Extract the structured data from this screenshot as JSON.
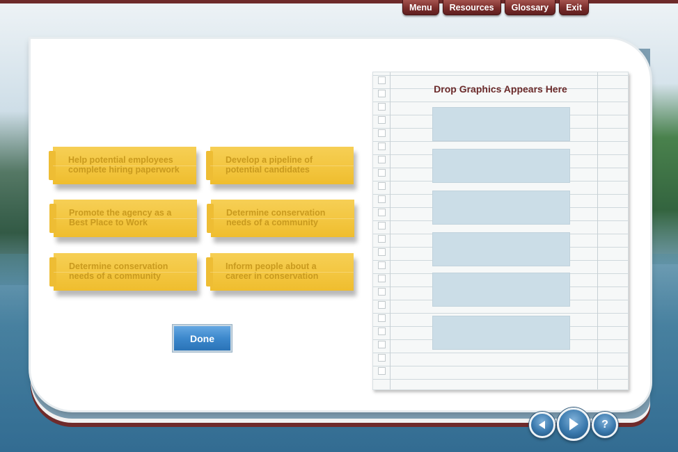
{
  "nav": {
    "menu": "Menu",
    "resources": "Resources",
    "glossary": "Glossary",
    "exit": "Exit"
  },
  "notes": [
    {
      "text": "Help potential employees complete hiring paperwork"
    },
    {
      "text": "Develop a pipeline of potential candidates"
    },
    {
      "text": "Promote the agency as a Best Place to Work"
    },
    {
      "text": "Determine conservation needs of a community"
    },
    {
      "text": "Determine conservation needs of a community"
    },
    {
      "text": "Inform people about a career in conservation"
    }
  ],
  "done_label": "Done",
  "notebook": {
    "title": "Drop Graphics Appears Here",
    "drop_zone_count": 6
  },
  "controls": {
    "back_icon": "back-arrow-icon",
    "next_icon": "next-arrow-icon",
    "help_icon": "help-icon",
    "help_glyph": "?"
  },
  "colors": {
    "nav": "#7b2d2b",
    "note": "#f3c640",
    "done": "#3c88cc",
    "drop_zone": "#cbdde7",
    "title": "#6b2a2a"
  }
}
